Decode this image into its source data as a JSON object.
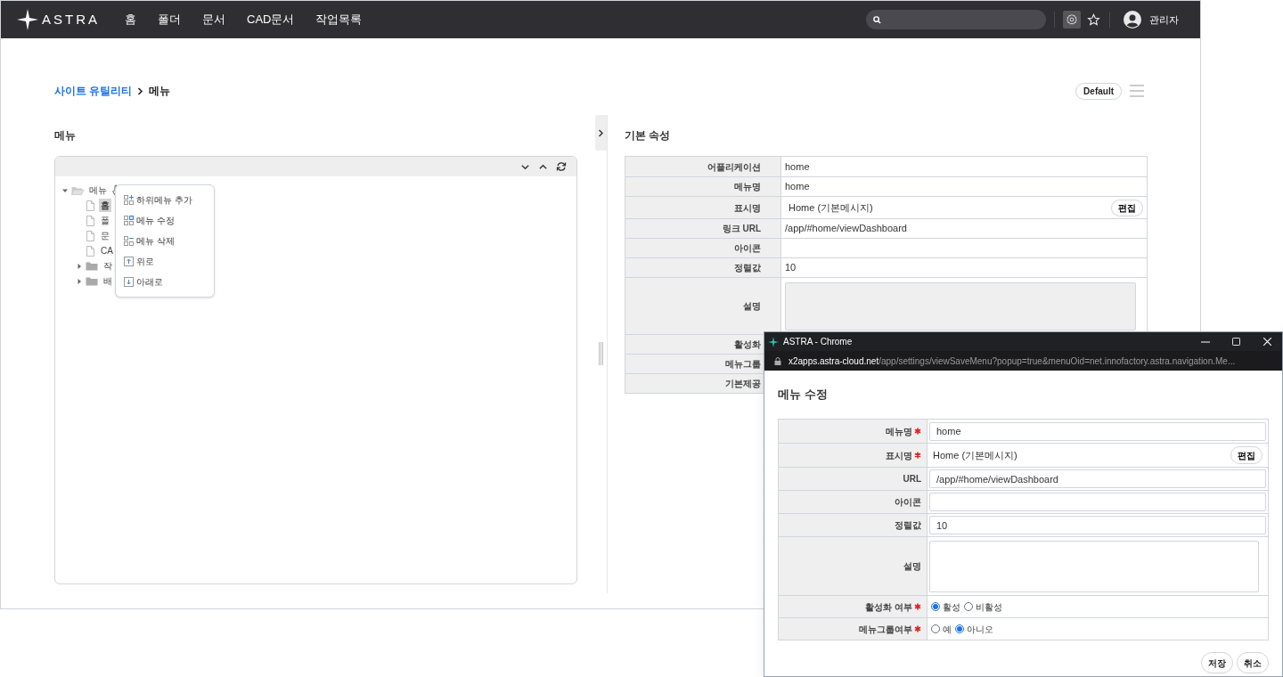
{
  "nav": {
    "logo": "ASTRA",
    "items": [
      {
        "label": "홈"
      },
      {
        "label": "폴더"
      },
      {
        "label": "문서"
      },
      {
        "label": "CAD문서"
      },
      {
        "label": "작업목록"
      }
    ],
    "user": "관리자"
  },
  "breadcrumb": [
    "사이트 유틸리티",
    "메뉴"
  ],
  "view_button": "Default",
  "menu_panel": {
    "title": "메뉴",
    "tree": [
      {
        "label": "메뉴",
        "kind": "folder",
        "expanded": true,
        "selected": false,
        "children": [
          {
            "label": "홈",
            "kind": "file",
            "selected": true
          },
          {
            "label": "폴",
            "kind": "file",
            "selected": false
          },
          {
            "label": "문",
            "kind": "file",
            "selected": false
          },
          {
            "label": "CA",
            "kind": "file",
            "selected": false
          },
          {
            "label": "작",
            "kind": "folder",
            "expanded": false,
            "selected": false
          },
          {
            "label": "배",
            "kind": "folder",
            "expanded": false,
            "selected": false
          }
        ]
      }
    ]
  },
  "context_menu": [
    {
      "label": "하위메뉴 추가",
      "kind": "add"
    },
    {
      "label": "메뉴 수정",
      "kind": "edit"
    },
    {
      "label": "메뉴 삭제",
      "kind": "delete"
    },
    {
      "label": "위로",
      "kind": "up"
    },
    {
      "label": "아래로",
      "kind": "down"
    }
  ],
  "properties": {
    "title": "기본 속성",
    "rows": [
      {
        "label": "어플리케이션",
        "kind": "text",
        "value": "home"
      },
      {
        "label": "메뉴명",
        "kind": "text",
        "value": "home"
      },
      {
        "label": "표시명",
        "kind": "message",
        "value": "Home (기본메시지)",
        "button": "편집"
      },
      {
        "label": "링크 URL",
        "kind": "text",
        "value": "/app/#home/viewDashboard"
      },
      {
        "label": "아이콘",
        "kind": "text"
      },
      {
        "label": "정렬값",
        "kind": "text",
        "value": "10"
      },
      {
        "label": "설명",
        "kind": "textarea"
      },
      {
        "label": "활성화",
        "kind": "text"
      },
      {
        "label": "메뉴그룹",
        "kind": "text"
      },
      {
        "label": "기본제공",
        "kind": "text"
      }
    ]
  },
  "popup": {
    "title": "ASTRA - Chrome",
    "url_host": "x2apps.astra-cloud.net",
    "url_path": "/app/settings/viewSaveMenu?popup=true&menuOid=net.innofactory.astra.navigation.Me...",
    "heading": "메뉴 수정",
    "rows": [
      {
        "label": "메뉴명",
        "required": true,
        "kind": "input",
        "value": "home"
      },
      {
        "label": "표시명",
        "required": true,
        "kind": "message",
        "value": "Home (기본메시지)",
        "button": "편집"
      },
      {
        "label": "URL",
        "required": false,
        "kind": "input",
        "value": "/app/#home/viewDashboard"
      },
      {
        "label": "아이콘",
        "required": false,
        "kind": "input"
      },
      {
        "label": "정렬값",
        "required": false,
        "kind": "input",
        "value": "10"
      },
      {
        "label": "설명",
        "required": false,
        "kind": "textarea"
      },
      {
        "label": "활성화 여부",
        "required": true,
        "kind": "radio",
        "options": [
          {
            "label": "활성",
            "selected": true
          },
          {
            "label": "비활성",
            "selected": false
          }
        ]
      },
      {
        "label": "메뉴그룹여부",
        "required": true,
        "kind": "radio",
        "options": [
          {
            "label": "예",
            "selected": false
          },
          {
            "label": "아니오",
            "selected": true
          }
        ]
      }
    ],
    "buttons": [
      "저장",
      "취소"
    ]
  }
}
